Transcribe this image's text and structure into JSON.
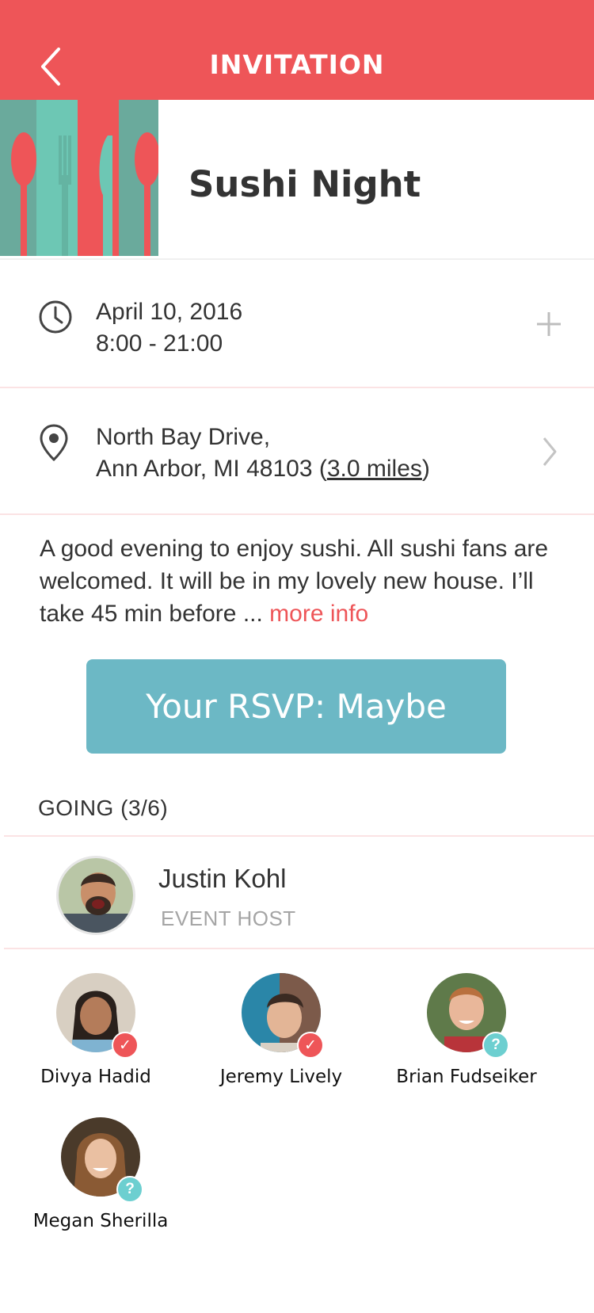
{
  "header": {
    "title": "INVITATION",
    "back_icon": "chevron-left-icon",
    "background_color": "#ee5558"
  },
  "event": {
    "title": "Sushi Night",
    "image": "cutlery-illustration"
  },
  "schedule": {
    "date": "April 10, 2016",
    "time": "8:00 - 21:00",
    "icon": "clock-icon",
    "action_icon": "plus-icon"
  },
  "location": {
    "street": "North Bay Drive,",
    "city": "Ann Arbor, MI 48103 (",
    "distance": "3.0 miles",
    "close_paren": ")",
    "icon": "map-pin-icon",
    "action_icon": "chevron-right-icon"
  },
  "description": {
    "text": "A good evening to enjoy sushi. All sushi fans are welcomed. It will be in my lovely new house. I’ll take  45 min before ...",
    "more_label": "more info"
  },
  "rsvp": {
    "label": "Your RSVP: Maybe",
    "color": "#6cb8c5"
  },
  "going": {
    "label": "GOING (3/6)"
  },
  "host": {
    "name": "Justin Kohl",
    "role": "EVENT HOST"
  },
  "guests": [
    {
      "name": "Divya Hadid",
      "status": "going",
      "badge": "✓"
    },
    {
      "name": "Jeremy Lively",
      "status": "going",
      "badge": "✓"
    },
    {
      "name": "Brian Fudseiker",
      "status": "maybe",
      "badge": "?"
    },
    {
      "name": "Megan Sherilla",
      "status": "maybe",
      "badge": "?"
    }
  ],
  "colors": {
    "accent": "#ee5558",
    "teal": "#6cb8c5",
    "maybe_badge": "#6dcfd0"
  }
}
